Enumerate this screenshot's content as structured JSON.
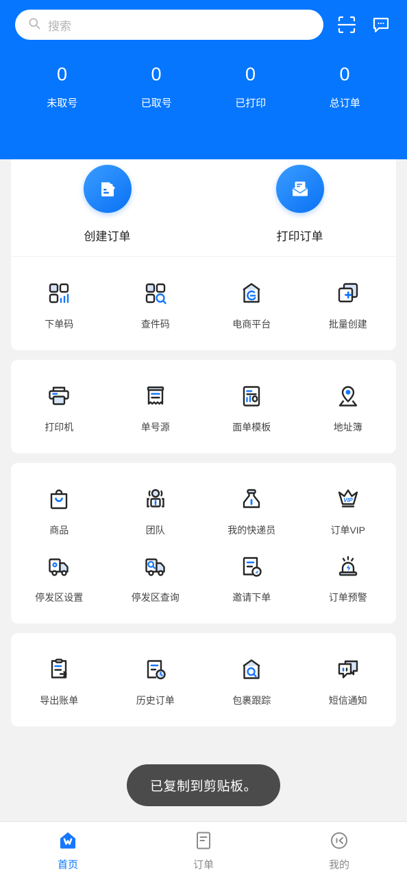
{
  "theme": {
    "header_blue": "#0676FF",
    "accent_blue": "#1677FF",
    "icon_dark": "#262626",
    "icon_fill_light": "#D6E4F7",
    "page_bg": "#F2F2F2",
    "card_bg": "#FFFFFF",
    "toast_bg": "#4B4B4B"
  },
  "header": {
    "search": {
      "placeholder": "搜索",
      "icon": "search-icon"
    },
    "scan_icon": "scan-code-icon",
    "message_icon": "chat-message-icon",
    "stats": [
      {
        "value": "0",
        "label": "未取号"
      },
      {
        "value": "0",
        "label": "已取号"
      },
      {
        "value": "0",
        "label": "已打印"
      },
      {
        "value": "0",
        "label": "总订单"
      }
    ]
  },
  "primary_actions": [
    {
      "label": "创建订单",
      "icon": "document-download-icon"
    },
    {
      "label": "打印订单",
      "icon": "envelope-document-icon"
    }
  ],
  "sections": [
    {
      "name": "codes-and-platform",
      "items": [
        {
          "label": "下单码",
          "icon": "qr-order-code-icon"
        },
        {
          "label": "查件码",
          "icon": "qr-search-code-icon"
        },
        {
          "label": "电商平台",
          "icon": "ecommerce-box-icon"
        },
        {
          "label": "批量创建",
          "icon": "batch-create-icon"
        }
      ]
    },
    {
      "name": "printing-tools",
      "items": [
        {
          "label": "打印机",
          "icon": "printer-icon"
        },
        {
          "label": "单号源",
          "icon": "receipt-icon"
        },
        {
          "label": "面单模板",
          "icon": "waybill-template-icon"
        },
        {
          "label": "地址簿",
          "icon": "address-book-pin-icon"
        }
      ]
    },
    {
      "name": "business-tools",
      "items": [
        {
          "label": "商品",
          "icon": "shopping-bag-icon"
        },
        {
          "label": "团队",
          "icon": "team-person-icon"
        },
        {
          "label": "我的快递员",
          "icon": "courier-icon"
        },
        {
          "label": "订单VIP",
          "icon": "vip-crown-icon"
        },
        {
          "label": "停发区设置",
          "icon": "truck-settings-icon"
        },
        {
          "label": "停发区查询",
          "icon": "truck-search-icon"
        },
        {
          "label": "邀请下单",
          "icon": "invite-order-icon"
        },
        {
          "label": "订单预警",
          "icon": "alarm-warning-icon"
        }
      ]
    },
    {
      "name": "records-and-notice",
      "items": [
        {
          "label": "导出账单",
          "icon": "export-bill-icon"
        },
        {
          "label": "历史订单",
          "icon": "history-order-icon"
        },
        {
          "label": "包裹跟踪",
          "icon": "package-tracking-icon"
        },
        {
          "label": "短信通知",
          "icon": "sms-notice-icon"
        }
      ]
    }
  ],
  "toast": {
    "message": "已复制到剪贴板。"
  },
  "tabbar": [
    {
      "label": "首页",
      "icon": "home-icon",
      "active": true
    },
    {
      "label": "订单",
      "icon": "order-list-icon",
      "active": false
    },
    {
      "label": "我的",
      "icon": "profile-icon",
      "active": false
    }
  ]
}
